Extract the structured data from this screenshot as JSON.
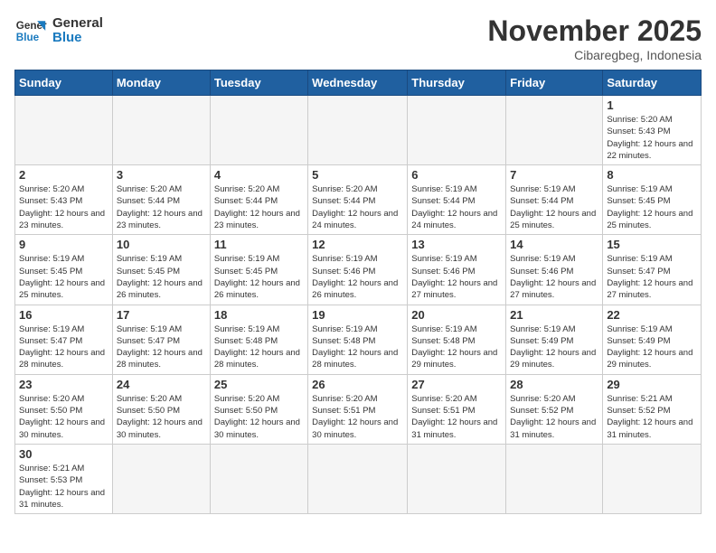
{
  "header": {
    "logo_general": "General",
    "logo_blue": "Blue",
    "month_title": "November 2025",
    "location": "Cibaregbeg, Indonesia"
  },
  "weekdays": [
    "Sunday",
    "Monday",
    "Tuesday",
    "Wednesday",
    "Thursday",
    "Friday",
    "Saturday"
  ],
  "weeks": [
    [
      {
        "day": "",
        "info": ""
      },
      {
        "day": "",
        "info": ""
      },
      {
        "day": "",
        "info": ""
      },
      {
        "day": "",
        "info": ""
      },
      {
        "day": "",
        "info": ""
      },
      {
        "day": "",
        "info": ""
      },
      {
        "day": "1",
        "info": "Sunrise: 5:20 AM\nSunset: 5:43 PM\nDaylight: 12 hours\nand 22 minutes."
      }
    ],
    [
      {
        "day": "2",
        "info": "Sunrise: 5:20 AM\nSunset: 5:43 PM\nDaylight: 12 hours\nand 23 minutes."
      },
      {
        "day": "3",
        "info": "Sunrise: 5:20 AM\nSunset: 5:44 PM\nDaylight: 12 hours\nand 23 minutes."
      },
      {
        "day": "4",
        "info": "Sunrise: 5:20 AM\nSunset: 5:44 PM\nDaylight: 12 hours\nand 23 minutes."
      },
      {
        "day": "5",
        "info": "Sunrise: 5:20 AM\nSunset: 5:44 PM\nDaylight: 12 hours\nand 24 minutes."
      },
      {
        "day": "6",
        "info": "Sunrise: 5:19 AM\nSunset: 5:44 PM\nDaylight: 12 hours\nand 24 minutes."
      },
      {
        "day": "7",
        "info": "Sunrise: 5:19 AM\nSunset: 5:44 PM\nDaylight: 12 hours\nand 25 minutes."
      },
      {
        "day": "8",
        "info": "Sunrise: 5:19 AM\nSunset: 5:45 PM\nDaylight: 12 hours\nand 25 minutes."
      }
    ],
    [
      {
        "day": "9",
        "info": "Sunrise: 5:19 AM\nSunset: 5:45 PM\nDaylight: 12 hours\nand 25 minutes."
      },
      {
        "day": "10",
        "info": "Sunrise: 5:19 AM\nSunset: 5:45 PM\nDaylight: 12 hours\nand 26 minutes."
      },
      {
        "day": "11",
        "info": "Sunrise: 5:19 AM\nSunset: 5:45 PM\nDaylight: 12 hours\nand 26 minutes."
      },
      {
        "day": "12",
        "info": "Sunrise: 5:19 AM\nSunset: 5:46 PM\nDaylight: 12 hours\nand 26 minutes."
      },
      {
        "day": "13",
        "info": "Sunrise: 5:19 AM\nSunset: 5:46 PM\nDaylight: 12 hours\nand 27 minutes."
      },
      {
        "day": "14",
        "info": "Sunrise: 5:19 AM\nSunset: 5:46 PM\nDaylight: 12 hours\nand 27 minutes."
      },
      {
        "day": "15",
        "info": "Sunrise: 5:19 AM\nSunset: 5:47 PM\nDaylight: 12 hours\nand 27 minutes."
      }
    ],
    [
      {
        "day": "16",
        "info": "Sunrise: 5:19 AM\nSunset: 5:47 PM\nDaylight: 12 hours\nand 28 minutes."
      },
      {
        "day": "17",
        "info": "Sunrise: 5:19 AM\nSunset: 5:47 PM\nDaylight: 12 hours\nand 28 minutes."
      },
      {
        "day": "18",
        "info": "Sunrise: 5:19 AM\nSunset: 5:48 PM\nDaylight: 12 hours\nand 28 minutes."
      },
      {
        "day": "19",
        "info": "Sunrise: 5:19 AM\nSunset: 5:48 PM\nDaylight: 12 hours\nand 28 minutes."
      },
      {
        "day": "20",
        "info": "Sunrise: 5:19 AM\nSunset: 5:48 PM\nDaylight: 12 hours\nand 29 minutes."
      },
      {
        "day": "21",
        "info": "Sunrise: 5:19 AM\nSunset: 5:49 PM\nDaylight: 12 hours\nand 29 minutes."
      },
      {
        "day": "22",
        "info": "Sunrise: 5:19 AM\nSunset: 5:49 PM\nDaylight: 12 hours\nand 29 minutes."
      }
    ],
    [
      {
        "day": "23",
        "info": "Sunrise: 5:20 AM\nSunset: 5:50 PM\nDaylight: 12 hours\nand 30 minutes."
      },
      {
        "day": "24",
        "info": "Sunrise: 5:20 AM\nSunset: 5:50 PM\nDaylight: 12 hours\nand 30 minutes."
      },
      {
        "day": "25",
        "info": "Sunrise: 5:20 AM\nSunset: 5:50 PM\nDaylight: 12 hours\nand 30 minutes."
      },
      {
        "day": "26",
        "info": "Sunrise: 5:20 AM\nSunset: 5:51 PM\nDaylight: 12 hours\nand 30 minutes."
      },
      {
        "day": "27",
        "info": "Sunrise: 5:20 AM\nSunset: 5:51 PM\nDaylight: 12 hours\nand 31 minutes."
      },
      {
        "day": "28",
        "info": "Sunrise: 5:20 AM\nSunset: 5:52 PM\nDaylight: 12 hours\nand 31 minutes."
      },
      {
        "day": "29",
        "info": "Sunrise: 5:21 AM\nSunset: 5:52 PM\nDaylight: 12 hours\nand 31 minutes."
      }
    ],
    [
      {
        "day": "30",
        "info": "Sunrise: 5:21 AM\nSunset: 5:53 PM\nDaylight: 12 hours\nand 31 minutes."
      },
      {
        "day": "",
        "info": ""
      },
      {
        "day": "",
        "info": ""
      },
      {
        "day": "",
        "info": ""
      },
      {
        "day": "",
        "info": ""
      },
      {
        "day": "",
        "info": ""
      },
      {
        "day": "",
        "info": ""
      }
    ]
  ]
}
